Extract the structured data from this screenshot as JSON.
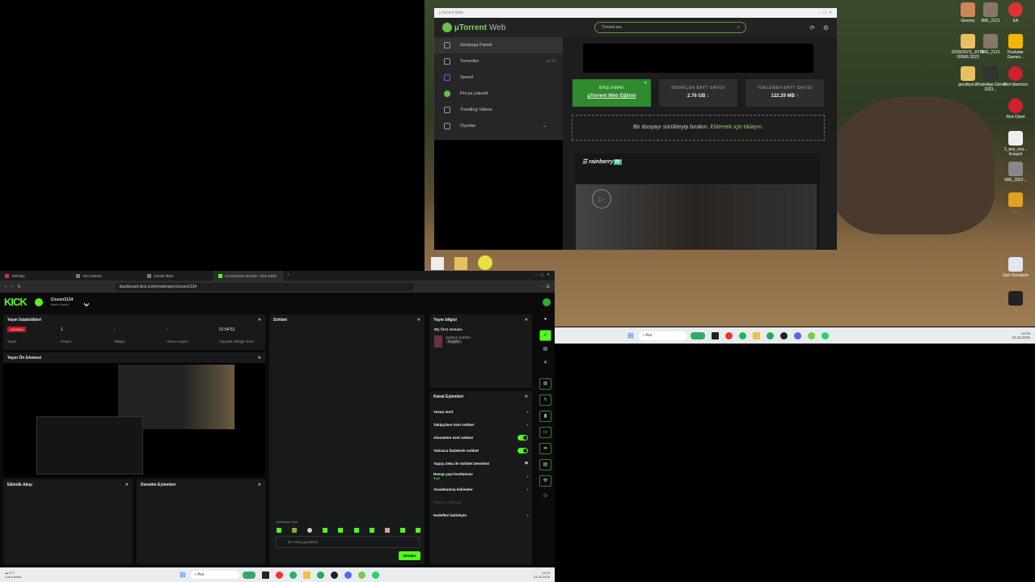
{
  "desktop": {
    "icons_right": [
      "Gloomy",
      "IMG_2121",
      "EA",
      "DOSOSYS_JOTFORMS 2023",
      "IMG_2121",
      "Rockstar Games...",
      "goodbye...",
      "WhatsApp Görsel 2023...",
      "Riot Istemcisi",
      "Riot Client",
      "1_any_sca... Kısayol",
      "IMG_2022...",
      "...",
      "Geri Dönüşüm",
      "..."
    ]
  },
  "utorrent": {
    "window_title": "µTorrent Web",
    "brand": "µTorrent",
    "brand_suffix": "Web",
    "search_placeholder": "Torrent ara",
    "sidebar": [
      {
        "label": "Gösterge Paneli",
        "active": true
      },
      {
        "label": "Torrentler",
        "badge_down": "0",
        "badge_up": "1"
      },
      {
        "label": "Speed"
      },
      {
        "label": "Pro'ya yükselt"
      },
      {
        "label": "Trending Videos"
      },
      {
        "label": "Oyunlar"
      }
    ],
    "start_card": {
      "title": "BAŞLAMAK",
      "link": "µTorrent Web Eğitimi"
    },
    "downloaded": {
      "label": "İNDİRİLEN BAYT SAYISI",
      "value": "2.76 GB ↓"
    },
    "uploaded": {
      "label": "YÜKLENEN BAYT SAYISI",
      "value": "122.29 MB ↑"
    },
    "drop_text": "Bir dosyayı sürükleyip bırakın.",
    "drop_link": "Eklemek için tıklayın.",
    "ad_brand": "rainberry",
    "ad_brand_tag": "tv"
  },
  "browser": {
    "tabs": [
      "TikFinity",
      "Yeni Sekme",
      "Görsel İlkick",
      "Ciozen3134 Stream - Kick Dash"
    ],
    "url": "dashboard.kick.com/moderator/ciozen3134"
  },
  "kick": {
    "logo": "KICK",
    "channel": "Ciozen3134",
    "role": "İçerik Üretici",
    "stats": {
      "title": "Yayın İstatistikleri",
      "live_badge": "YAYINDA",
      "items": [
        {
          "label": "Yayın",
          "value": ""
        },
        {
          "label": "İzleyici",
          "value": "1"
        },
        {
          "label": "Takipçi",
          "value": "-"
        },
        {
          "label": "Abone Sayısı",
          "value": "-"
        },
        {
          "label": "Yayında Olduğu Süre",
          "value": "01:54:51"
        }
      ]
    },
    "preview": {
      "title": "Yayın Ön İzlemesi"
    },
    "activity": {
      "title": "Etkinlik Akışı"
    },
    "mod_actions": {
      "title": "Denetim Eylemleri"
    },
    "chat": {
      "title": "Sohbet",
      "sub_only": "Abonelere Özel",
      "placeholder": "Bir mesaj gönderin",
      "send": "Gönder"
    },
    "stream_info": {
      "title": "Yayın bilgisi",
      "stream_title": "My first stream.",
      "category": "Sadece Sohbet",
      "language": "English"
    },
    "channel_actions": {
      "title": "Kanal Eylemleri",
      "items": [
        {
          "label": "Yavaş mod"
        },
        {
          "label": "Takipçilere özel sohbet"
        },
        {
          "label": "Abonelere özel sohbet",
          "toggle": true
        },
        {
          "label": "Yalnızca ifadelerle sohbet",
          "toggle": true
        },
        {
          "label": "Yapay Zeka ile Sohbet Denetimi"
        },
        {
          "label": "Hesap yaşı kısıtlaması",
          "sub": "3 yıl"
        },
        {
          "label": "Yasaklanmış kelimeler"
        },
        {
          "label": "İzleyici Yönlendir",
          "disabled": true
        },
        {
          "label": "Hedefleri belirleyin"
        }
      ]
    }
  },
  "taskbar_left": {
    "weather_temp": "5°C",
    "weather_text": "Çok bulutlu",
    "search": "Ara",
    "time": "14:34",
    "date": "24.03.2026"
  },
  "taskbar_right": {
    "search": "Ara",
    "time": "14:33",
    "date": "24.03.2026"
  },
  "colors": {
    "kick_green": "#53fc18",
    "utorrent_green": "#2e8b2e",
    "live_red": "#c4161c"
  }
}
